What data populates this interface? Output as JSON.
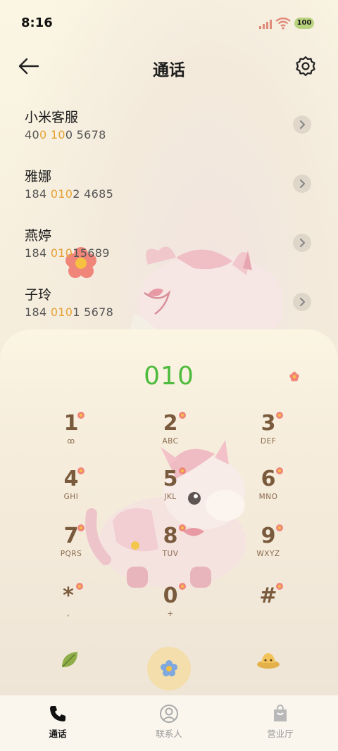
{
  "status_bar": {
    "time": "8:16",
    "battery": "100"
  },
  "header": {
    "title": "通话"
  },
  "contacts": [
    {
      "name": "小米客服",
      "number_parts": [
        "40",
        "0",
        " ",
        "10",
        "0 5678"
      ]
    },
    {
      "name": "雅娜",
      "number_parts": [
        "184 ",
        "010",
        "2 4685"
      ]
    },
    {
      "name": "燕婷",
      "number_parts": [
        "184 ",
        "010",
        "15689"
      ]
    },
    {
      "name": "子玲",
      "number_parts": [
        "184 ",
        "010",
        "1 5678"
      ]
    }
  ],
  "dialer": {
    "input": "010",
    "keys": [
      {
        "digit": "1",
        "letters": "ꝏ"
      },
      {
        "digit": "2",
        "letters": "ABC"
      },
      {
        "digit": "3",
        "letters": "DEF"
      },
      {
        "digit": "4",
        "letters": "GHI"
      },
      {
        "digit": "5",
        "letters": "JKL"
      },
      {
        "digit": "6",
        "letters": "MNO"
      },
      {
        "digit": "7",
        "letters": "PQRS"
      },
      {
        "digit": "8",
        "letters": "TUV"
      },
      {
        "digit": "9",
        "letters": "WXYZ"
      },
      {
        "digit": "*",
        "letters": ","
      },
      {
        "digit": "0",
        "letters": "+"
      },
      {
        "digit": "#",
        "letters": ""
      }
    ]
  },
  "bottom_nav": [
    {
      "label": "通话",
      "icon": "phone-icon",
      "active": true
    },
    {
      "label": "联系人",
      "icon": "contact-icon",
      "active": false
    },
    {
      "label": "营业厅",
      "icon": "shopping-bag-icon",
      "active": false
    }
  ],
  "colors": {
    "accent_green": "#4dbb3c",
    "highlight_orange": "#e6a235",
    "key_brown": "#7a5a3c"
  }
}
